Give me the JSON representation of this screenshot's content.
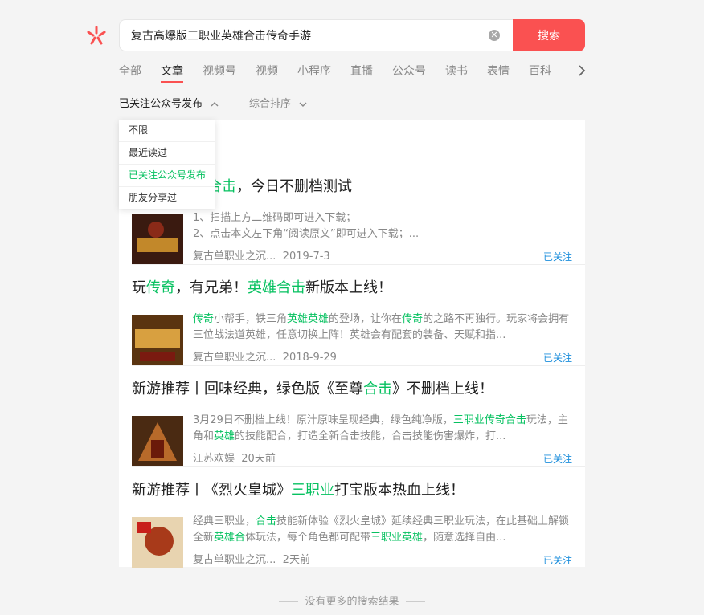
{
  "search": {
    "query": "复古高爆版三职业英雄合击传奇手游",
    "button_label": "搜索"
  },
  "tabs": [
    {
      "label": "全部"
    },
    {
      "label": "文章"
    },
    {
      "label": "视频号"
    },
    {
      "label": "视频"
    },
    {
      "label": "小程序"
    },
    {
      "label": "直播"
    },
    {
      "label": "公众号"
    },
    {
      "label": "读书"
    },
    {
      "label": "表情"
    },
    {
      "label": "百科"
    }
  ],
  "active_tab": "文章",
  "filters": {
    "scope": "已关注公众号发布",
    "sort": "综合排序",
    "dropdown_options": [
      "不限",
      "最近读过",
      "已关注公众号发布",
      "朋友分享过"
    ],
    "dropdown_selected": "已关注公众号发布"
  },
  "results": [
    {
      "title_parts": [
        {
          "t": "合击",
          "hl": true
        },
        {
          "t": "，今日不删档测试",
          "hl": false
        }
      ],
      "desc_lines": [
        "1、扫描上方二维码即可进入下载；",
        "2、点击本文左下角“阅读原文”即可进入下载；..."
      ],
      "source": "复古单职业之沉...",
      "time": "2019-7-3",
      "follow": "已关注"
    },
    {
      "title_parts": [
        {
          "t": "玩",
          "hl": false
        },
        {
          "t": "传奇",
          "hl": true
        },
        {
          "t": "，有兄弟！",
          "hl": false
        },
        {
          "t": "英雄合击",
          "hl": true
        },
        {
          "t": "新版本上线！",
          "hl": false
        }
      ],
      "desc_parts": [
        {
          "t": "传奇",
          "hl": true
        },
        {
          "t": "小帮手，铁三角",
          "hl": false
        },
        {
          "t": "英雄英雄",
          "hl": true
        },
        {
          "t": "的登场，让你在",
          "hl": false
        },
        {
          "t": "传奇",
          "hl": true
        },
        {
          "t": "的之路不再独行。玩家将会拥有三位战法道英雄，任意切换上阵！英雄会有配套的装备、天赋和指...",
          "hl": false
        }
      ],
      "source": "复古单职业之沉...",
      "time": "2018-9-29",
      "follow": "已关注"
    },
    {
      "title_parts": [
        {
          "t": "新游推荐丨回味经典，绿色版《至尊",
          "hl": false
        },
        {
          "t": "合击",
          "hl": true
        },
        {
          "t": "》不删档上线！",
          "hl": false
        }
      ],
      "desc_parts": [
        {
          "t": "3月29日不删档上线！原汁原味呈现经典，绿色纯净版，",
          "hl": false
        },
        {
          "t": "三职业传奇合击",
          "hl": true
        },
        {
          "t": "玩法，主角和",
          "hl": false
        },
        {
          "t": "英雄",
          "hl": true
        },
        {
          "t": "的技能配合，打造全新合击技能，合击技能伤害爆炸，打...",
          "hl": false
        }
      ],
      "source": "江苏欢娱",
      "time": "20天前",
      "follow": "已关注"
    },
    {
      "title_parts": [
        {
          "t": "新游推荐丨《烈火皇城》",
          "hl": false
        },
        {
          "t": "三职业",
          "hl": true
        },
        {
          "t": "打宝版本热血上线！",
          "hl": false
        }
      ],
      "desc_parts": [
        {
          "t": "经典三职业，",
          "hl": false
        },
        {
          "t": "合击",
          "hl": true
        },
        {
          "t": "技能新体验《烈火皇城》延续经典三职业玩法，在此基础上解锁全新",
          "hl": false
        },
        {
          "t": "英雄合",
          "hl": true
        },
        {
          "t": "体玩法，每个角色都可配带",
          "hl": false
        },
        {
          "t": "三职业英雄",
          "hl": true
        },
        {
          "t": "，随意选择自由...",
          "hl": false
        }
      ],
      "source": "复古单职业之沉...",
      "time": "2天前",
      "follow": "已关注"
    }
  ],
  "footer": "没有更多的搜索结果",
  "colors": {
    "accent": "#fa5151",
    "highlight": "#07c160",
    "link": "#1e8fdc"
  }
}
